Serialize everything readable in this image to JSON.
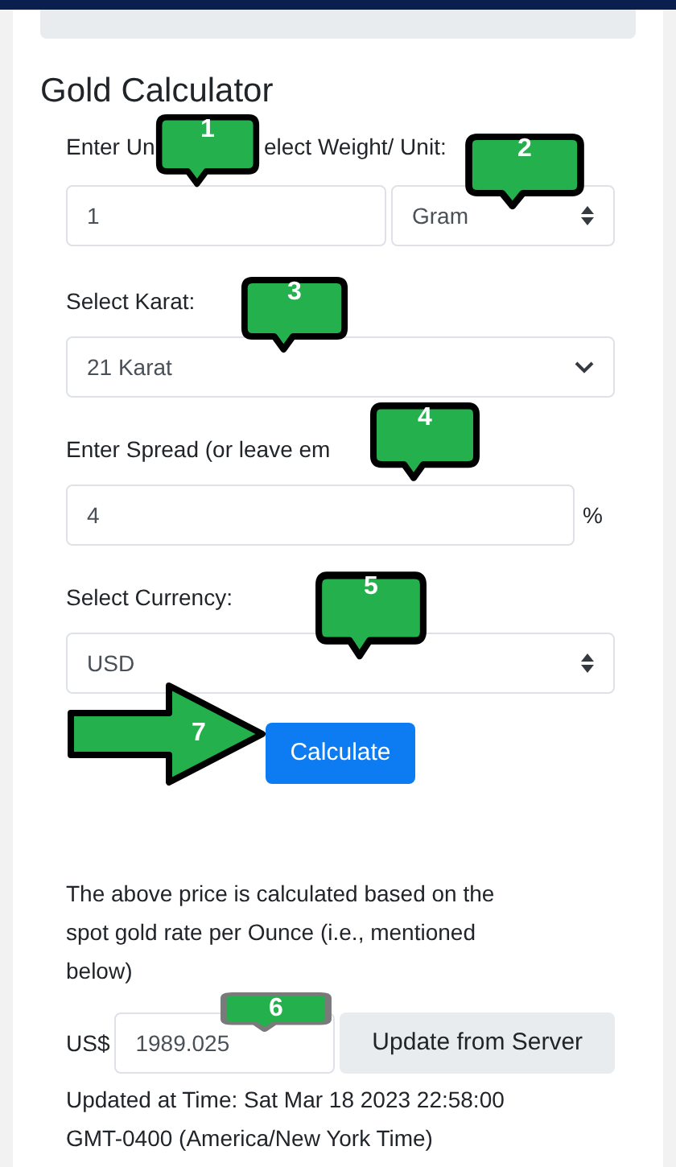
{
  "title": "Gold Calculator",
  "weight": {
    "label_parts": [
      "Enter Un",
      "elect Weight/ Unit:"
    ],
    "value": "1",
    "unit": "Gram"
  },
  "karat": {
    "label": "Select Karat:",
    "value": "21 Karat"
  },
  "spread": {
    "label": "Enter Spread (or leave em",
    "value": "4",
    "suffix": "%"
  },
  "currency": {
    "label": "Select Currency:",
    "value": "USD"
  },
  "calculate_button": "Calculate",
  "note": "The above price is calculated based on the spot gold rate per Ounce (i.e., mentioned below)",
  "spot": {
    "prefix": "US$",
    "value": "1989.025",
    "button": "Update from Server"
  },
  "updated": "Updated at Time: Sat Mar 18 2023 22:58:00 GMT-0400 (America/New York Time)",
  "callouts": [
    {
      "kind": "bubble",
      "number": "1",
      "color": "#000000"
    },
    {
      "kind": "bubble",
      "number": "2",
      "color": "#000000"
    },
    {
      "kind": "bubble",
      "number": "3",
      "color": "#000000"
    },
    {
      "kind": "bubble",
      "number": "4",
      "color": "#000000"
    },
    {
      "kind": "bubble",
      "number": "5",
      "color": "#000000"
    },
    {
      "kind": "bubble",
      "number": "6",
      "color": "#7a7a7a"
    },
    {
      "kind": "arrow",
      "number": "7",
      "color": "#000000"
    }
  ]
}
